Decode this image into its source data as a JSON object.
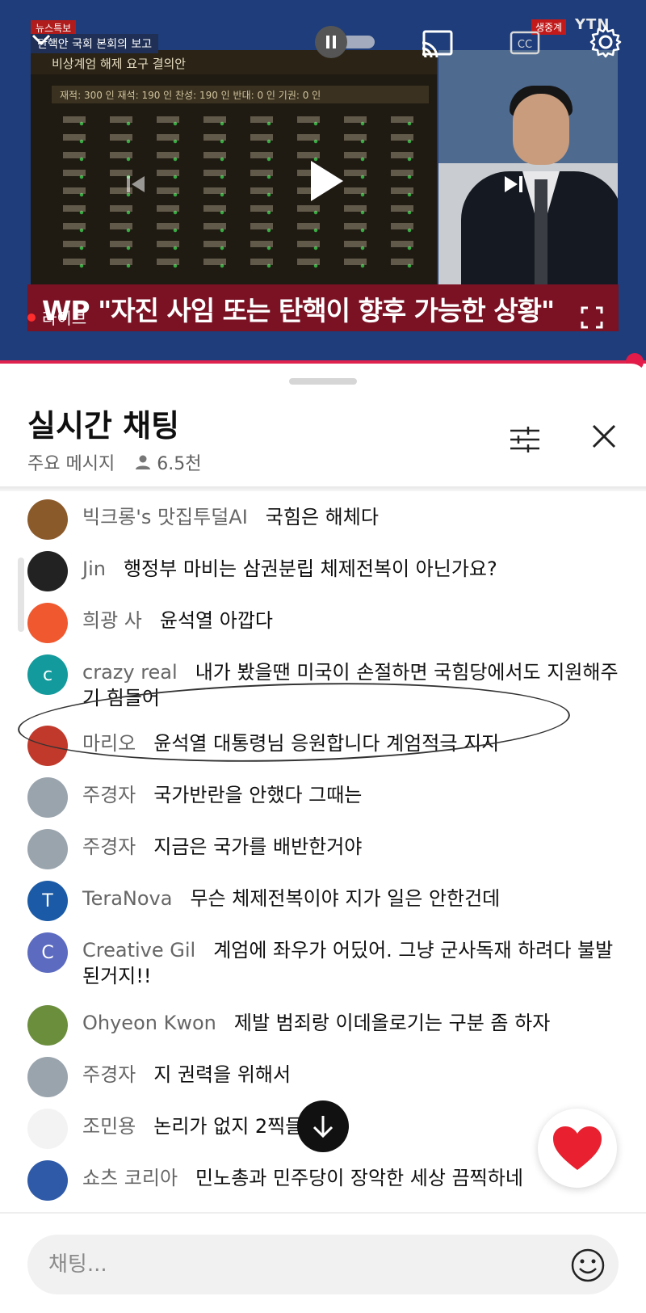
{
  "player": {
    "top_tag": "뉴스특보",
    "broadcast_title": "탄핵안 국회 본회의 보고",
    "frame_title": "비상계엄 해제 요구 결의안",
    "tally": "재적: 300 인   재석: 190 인   찬성: 190 인   반대: 0 인   기권: 0 인",
    "channel_tag": "생중계",
    "channel_logo": "YTN",
    "headline": "WP \"자진 사임 또는 탄핵이 향후 가능한 상황\"",
    "live_label": "라이브",
    "progress": 1.0
  },
  "chat": {
    "title": "실시간 채팅",
    "mode": "주요 메시지",
    "viewers": "6.5천",
    "input_placeholder": "채팅...",
    "messages": [
      {
        "author": "빅크롱's 맛집투덜AI",
        "text": "국힘은 해체다",
        "avatar_initial": "",
        "avatar_color": "#8b5a2b"
      },
      {
        "author": "Jin",
        "text": "행정부 마비는 삼권분립 체제전복이 아닌가요?",
        "avatar_initial": "",
        "avatar_color": "#222222"
      },
      {
        "author": "희광 사",
        "text": "윤석열 아깝다",
        "avatar_initial": "",
        "avatar_color": "#f0582f"
      },
      {
        "author": "crazy real",
        "text": "내가 봤을땐 미국이 손절하면 국힘당에서도 지원해주기 힘들어",
        "avatar_initial": "c",
        "avatar_color": "#139a9c"
      },
      {
        "author": "마리오",
        "text": "윤석열 대통령님 응원합니다 계엄적극 지지",
        "avatar_initial": "",
        "avatar_color": "#c0392b"
      },
      {
        "author": "주경자",
        "text": "국가반란을 안했다 그때는",
        "avatar_initial": "",
        "avatar_color": "#9aa4ad"
      },
      {
        "author": "주경자",
        "text": "지금은 국가를 배반한거야",
        "avatar_initial": "",
        "avatar_color": "#9aa4ad"
      },
      {
        "author": "TeraNova",
        "text": "무슨 체제전복이야 지가 일은 안한건데",
        "avatar_initial": "T",
        "avatar_color": "#1a5aa6"
      },
      {
        "author": "Creative Gil",
        "text": "계엄에 좌우가 어딨어. 그냥 군사독재 하려다 불발 된거지!!",
        "avatar_initial": "C",
        "avatar_color": "#5c6bc0"
      },
      {
        "author": "Ohyeon Kwon",
        "text": "제발 범죄랑 이데올로기는 구분 좀 하자",
        "avatar_initial": "",
        "avatar_color": "#6b8e3d"
      },
      {
        "author": "주경자",
        "text": "지 권력을 위해서",
        "avatar_initial": "",
        "avatar_color": "#9aa4ad"
      },
      {
        "author": "조민용",
        "text": "논리가 없지 2찍들은",
        "avatar_initial": "",
        "avatar_color": "#f3f3f3"
      },
      {
        "author": "쇼츠 코리아",
        "text": "민노총과 민주당이 장악한 세상 끔찍하네",
        "avatar_initial": "",
        "avatar_color": "#2f5aa8"
      }
    ]
  },
  "colors": {
    "accent_red": "#e0234e",
    "heart": "#e8202f"
  }
}
